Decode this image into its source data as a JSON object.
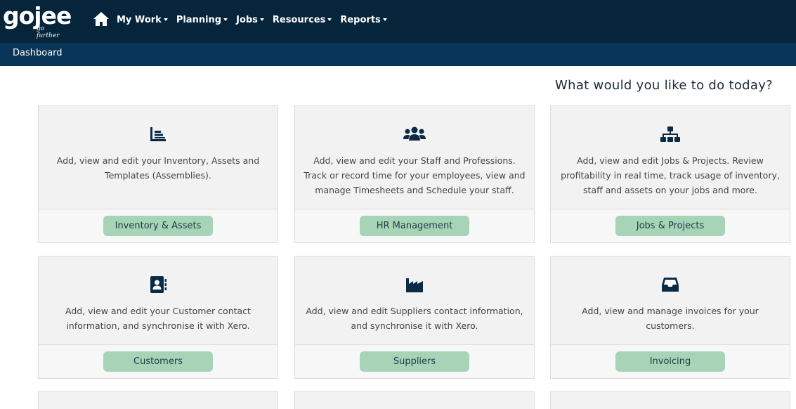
{
  "brand": {
    "name": "gojee",
    "tagline": "go further"
  },
  "nav": {
    "home_icon": "home-icon",
    "items": [
      {
        "label": "My Work"
      },
      {
        "label": "Planning"
      },
      {
        "label": "Jobs"
      },
      {
        "label": "Resources"
      },
      {
        "label": "Reports"
      }
    ]
  },
  "breadcrumb": "Dashboard",
  "heading": "What would you like to do today?",
  "cards": [
    {
      "icon": "inventory-icon",
      "text": "Add, view and edit your Inventory, Assets and Templates (Assemblies).",
      "button": "Inventory & Assets"
    },
    {
      "icon": "users-icon",
      "text": "Add, view and edit your Staff and Professions. Track or record time for your employees, view and manage Timesheets and Schedule your staff.",
      "button": "HR Management"
    },
    {
      "icon": "sitemap-icon",
      "text": "Add, view and edit Jobs & Projects. Review profitability in real time, track usage of inventory, staff and assets on your jobs and more.",
      "button": "Jobs & Projects"
    },
    {
      "icon": "address-book-icon",
      "text": "Add, view and edit your Customer contact information, and synchronise it with Xero.",
      "button": "Customers"
    },
    {
      "icon": "industry-icon",
      "text": "Add, view and edit Suppliers contact information, and synchronise it with Xero.",
      "button": "Suppliers"
    },
    {
      "icon": "inbox-icon",
      "text": "Add, view and manage invoices for your customers.",
      "button": "Invoicing"
    }
  ],
  "colors": {
    "nav_bg": "#06243a",
    "subbar_bg": "#083558",
    "button_bg": "#a7d4b6",
    "icon": "#0b2a45"
  }
}
